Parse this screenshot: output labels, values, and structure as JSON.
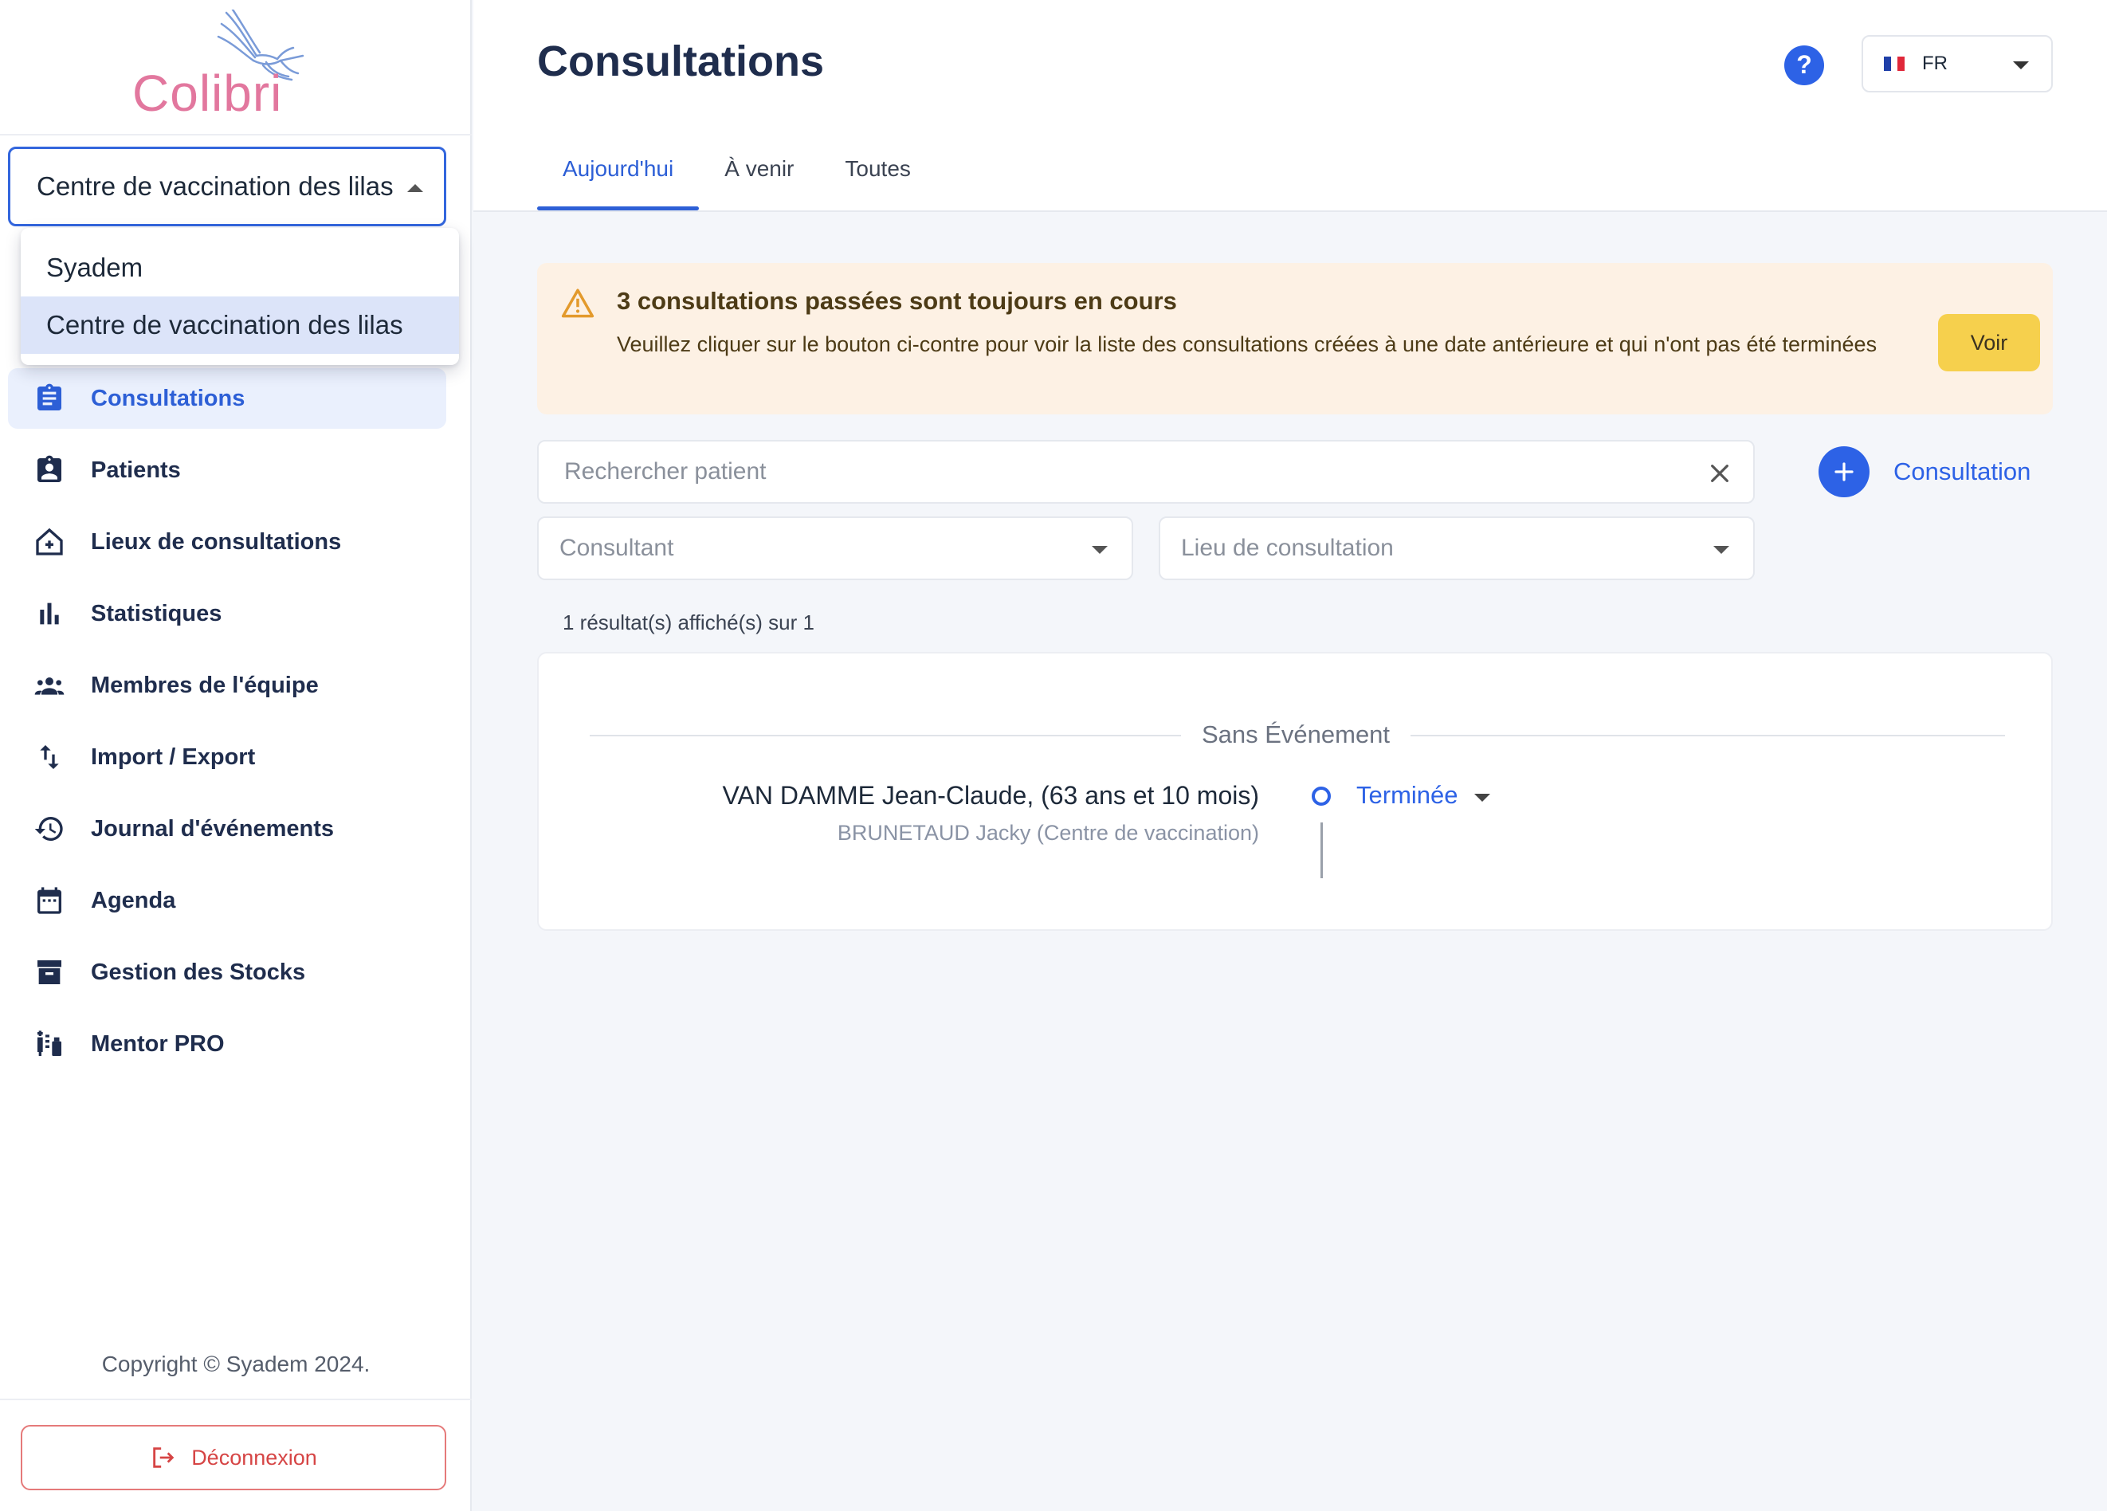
{
  "sidebar": {
    "logo_text": "Colibri",
    "center_select": {
      "value": "Centre de vaccination des lilas"
    },
    "dropdown_options": [
      {
        "label": "Syadem",
        "selected": false
      },
      {
        "label": "Centre de vaccination des lilas",
        "selected": true
      }
    ],
    "nav": [
      {
        "label": "Consultations",
        "icon": "clipboard-icon",
        "active": true
      },
      {
        "label": "Patients",
        "icon": "patient-badge-icon",
        "active": false
      },
      {
        "label": "Lieux de consultations",
        "icon": "clinic-house-icon",
        "active": false
      },
      {
        "label": "Statistiques",
        "icon": "bar-chart-icon",
        "active": false
      },
      {
        "label": "Membres de l'équipe",
        "icon": "team-icon",
        "active": false
      },
      {
        "label": "Import / Export",
        "icon": "import-export-icon",
        "active": false
      },
      {
        "label": "Journal d'événements",
        "icon": "history-icon",
        "active": false
      },
      {
        "label": "Agenda",
        "icon": "calendar-icon",
        "active": false
      },
      {
        "label": "Gestion des Stocks",
        "icon": "archive-box-icon",
        "active": false
      },
      {
        "label": "Mentor PRO",
        "icon": "vaccine-icon",
        "active": false
      }
    ],
    "copyright": "Copyright © Syadem 2024.",
    "logout_label": "Déconnexion"
  },
  "header": {
    "title": "Consultations",
    "language": "FR",
    "tabs": [
      {
        "label": "Aujourd'hui",
        "active": true
      },
      {
        "label": "À venir",
        "active": false
      },
      {
        "label": "Toutes",
        "active": false
      }
    ]
  },
  "alert": {
    "title": "3 consultations passées sont toujours en cours",
    "text": "Veuillez cliquer sur le bouton ci-contre pour voir la liste des consultations créées à une date antérieure et qui n'ont pas été terminées",
    "button_label": "Voir"
  },
  "search": {
    "placeholder": "Rechercher patient"
  },
  "add_consultation_label": "Consultation",
  "filters": {
    "consultant_placeholder": "Consultant",
    "lieu_placeholder": "Lieu de consultation"
  },
  "results": {
    "count_text": "1 résultat(s) affiché(s) sur 1",
    "group_label": "Sans Événement",
    "items": [
      {
        "patient": "VAN DAMME Jean-Claude, (63 ans et 10 mois)",
        "consultant": "BRUNETAUD Jacky (Centre de vaccination)",
        "status": "Terminée"
      }
    ]
  },
  "colors": {
    "primary": "#2d62e6",
    "nav_active": "#2d5fd6",
    "alert_bg": "#fdf1e4",
    "alert_button": "#f6d04d",
    "logout": "#d64545",
    "logo_pink": "#e2779e"
  }
}
